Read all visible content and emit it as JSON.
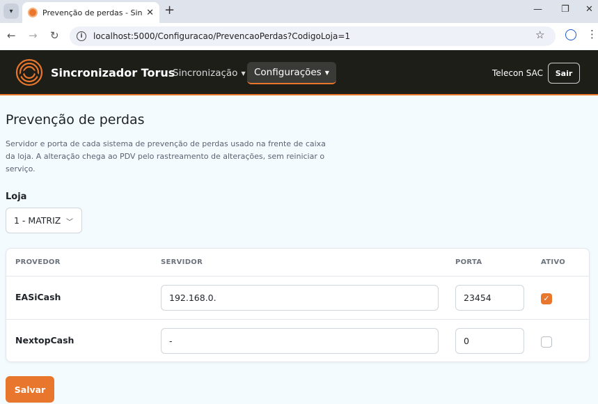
{
  "browser": {
    "tab_title": "Prevenção de perdas - Sincroni",
    "url_host": "localhost",
    "url_path": ":5000/Configuracao/PrevencaoPerdas?CodigoLoja=1"
  },
  "navbar": {
    "brand": "Sincronizador Torus",
    "menu_sync": "Sincronização",
    "menu_config": "Configurações",
    "user": "Telecon SAC",
    "logout": "Sair"
  },
  "page": {
    "title": "Prevenção de perdas",
    "description": "Servidor e porta de cada sistema de prevenção de perdas usado na frente de caixa da loja. A alteração chega ao PDV pelo rastreamento de alterações, sem reiniciar o serviço.",
    "store_label": "Loja",
    "store_selected": "1 - MATRIZ"
  },
  "table": {
    "headers": {
      "provider": "PROVEDOR",
      "server": "SERVIDOR",
      "port": "PORTA",
      "active": "ATIVO"
    },
    "rows": [
      {
        "provider": "EASiCash",
        "server": "192.168.0.",
        "port": "23454",
        "active": true
      },
      {
        "provider": "NextopCash",
        "server": "-",
        "port": "0",
        "active": false
      }
    ]
  },
  "actions": {
    "save": "Salvar"
  },
  "colors": {
    "accent": "#e8762d",
    "navbar_bg": "#1e1e19",
    "page_bg": "#f4fbff"
  }
}
